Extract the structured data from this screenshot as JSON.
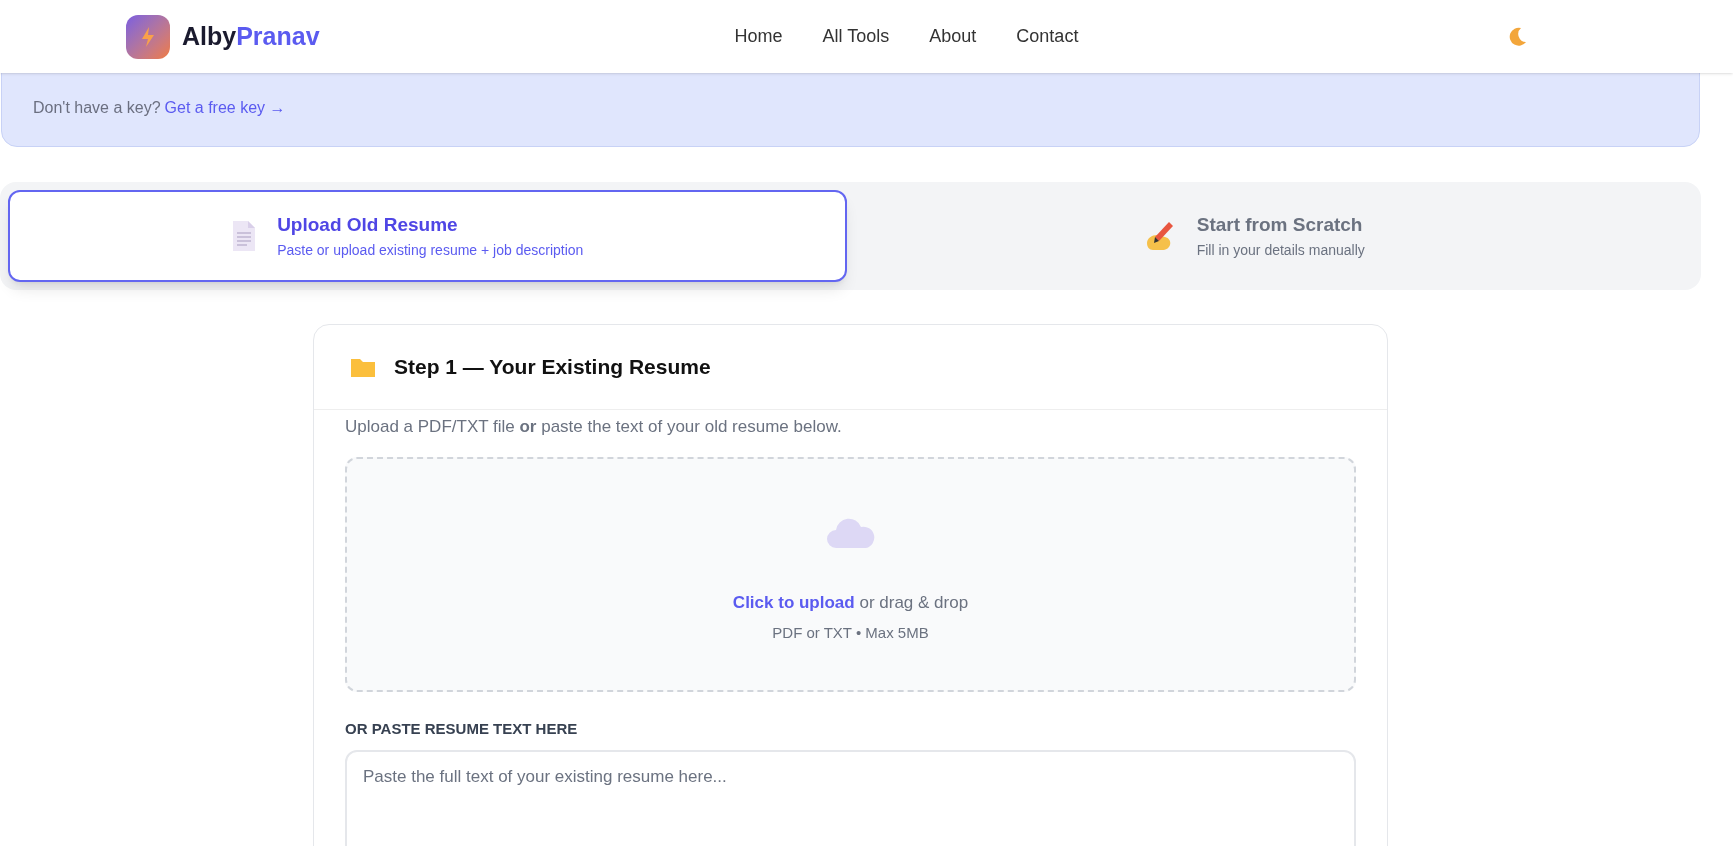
{
  "brand": {
    "first": "Alby",
    "second": "Pranav"
  },
  "nav": [
    "Home",
    "All Tools",
    "About",
    "Contact"
  ],
  "key_banner": {
    "text": "Don't have a key?",
    "link": "Get a free key →"
  },
  "modes": [
    {
      "kind": "upload",
      "title": "Upload Old Resume",
      "subtitle": "Paste or upload existing resume + job description",
      "selected": true
    },
    {
      "kind": "scratch",
      "title": "Start from Scratch",
      "subtitle": "Fill in your details manually",
      "selected": false
    }
  ],
  "step": {
    "title": "Step 1 — Your Existing Resume",
    "hint": "Upload a PDF/TXT file **or** paste the text of your old resume below.",
    "dropzone": {
      "link": "Click to upload",
      "text": "or drag & drop",
      "note": "PDF or TXT • Max 5MB"
    },
    "paste_label": "OR PASTE RESUME TEXT HERE",
    "paste_placeholder": "Paste the full text of your existing resume here..."
  }
}
